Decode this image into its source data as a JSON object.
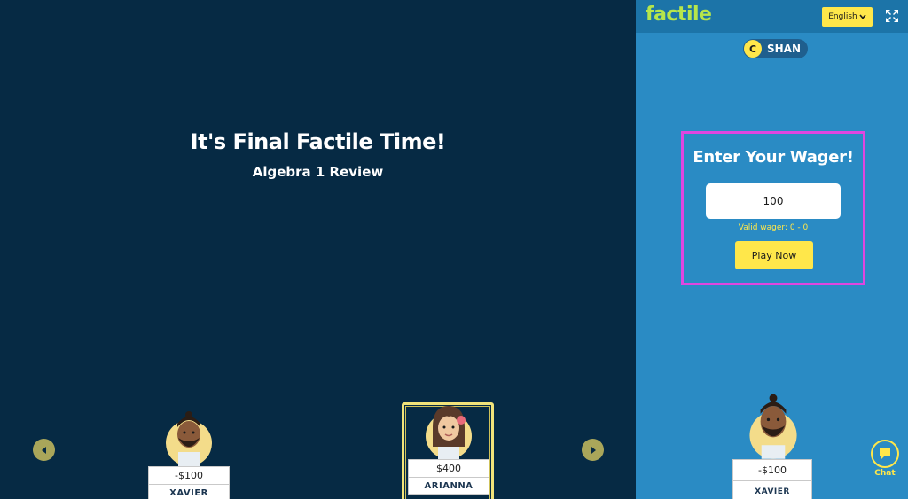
{
  "stage": {
    "title": "It's Final Factile Time!",
    "subtitle": "Algebra 1 Review",
    "players": [
      {
        "name": "XAVIER",
        "score": "-$100"
      },
      {
        "name": "ARIANNA",
        "score": "$400"
      }
    ]
  },
  "panel": {
    "logo": "factile",
    "language": "English",
    "user": {
      "initial": "C",
      "name": "SHAN"
    },
    "wager": {
      "title": "Enter Your Wager!",
      "value": "100",
      "valid_text": "Valid wager: 0 - 0",
      "play_label": "Play Now"
    },
    "self_player": {
      "name": "XAVIER",
      "score": "-$100"
    },
    "chat_label": "Chat"
  },
  "colors": {
    "stage_bg": "#062a44",
    "panel_bg": "#2a8bc4",
    "accent_yellow": "#ffe74a",
    "logo_green": "#b6e64b",
    "highlight_magenta": "#e045e0"
  }
}
